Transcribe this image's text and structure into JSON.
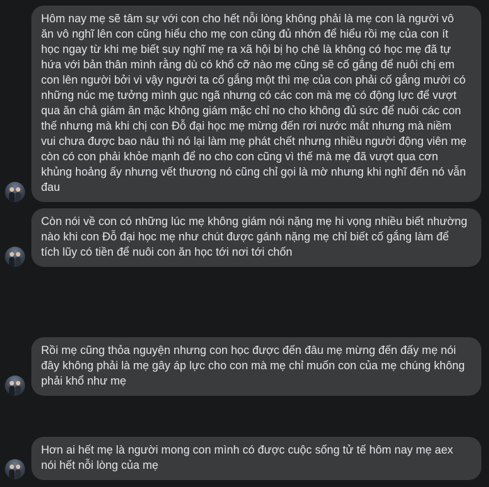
{
  "messages": [
    {
      "text": "Hôm nay mẹ sẽ tâm sự với con cho hết nỗi lòng không  phải là mẹ con là người vô\năn vô nghĩ lên con cũng hiểu cho mẹ con cũng đủ nhớn để hiểu rồi mẹ của con ít\nhọc ngay từ khi mẹ biết suy nghĩ mẹ ra xã hội bị họ chê là không có học mẹ đã tự\nhứa với bản thân mình rằng dù có khổ cỡ nào mẹ cũng sẽ cố gắng để nuôi chị em\ncon lên người bởi vì vậy người ta cố gắng một thì mẹ của con phải cố gắng mười có\nnhững núc mẹ tưởng mình gục ngã nhưng có các con mà mẹ có động lực để vượt\nqua ăn chả giám ăn mặc không giám mặc chỉ no cho không đủ sức để nuôi các con\nthế nhưng mà khi chị con Đỗ đại học mẹ mừng đến rơi nước mắt nhưng mà niềm\nvui chưa được bao nâu thì nó lại làm mẹ phát chết nhưng nhiều người động viên mẹ\ncòn có con phải khỏe mạnh để no cho con cũng vì thế mà mẹ đã vượt qua cơn\nkhủng hoảng ấy nhưng vết thương nó cũng chỉ gọi là mờ nhưng khi nghĩ đến nó vẫn\nđau"
    },
    {
      "text": "Còn nói về con có những lúc mẹ không giám nói nặng mẹ hi vọng nhiều biết nhường\nnào khi con Đỗ đại học mẹ như chút được gánh nặng mẹ chỉ biết cố gắng làm để\ntích lũy có tiền để nuôi con ăn học tới nơi tới chốn"
    },
    {
      "text": "Rồi mẹ cũng thỏa nguyện nhưng con học được đến đâu mẹ mừng đến đấy mẹ nói\nđây không phải là mẹ gây áp lực cho con mà mẹ chỉ muốn con của mẹ chúng không\nphải khổ như mẹ"
    },
    {
      "text": "Hơn ai hết mẹ là người mong con mình có được cuộc sống tử tế hôm nay mẹ aex\nnói hết nỗi lòng của mẹ"
    }
  ]
}
